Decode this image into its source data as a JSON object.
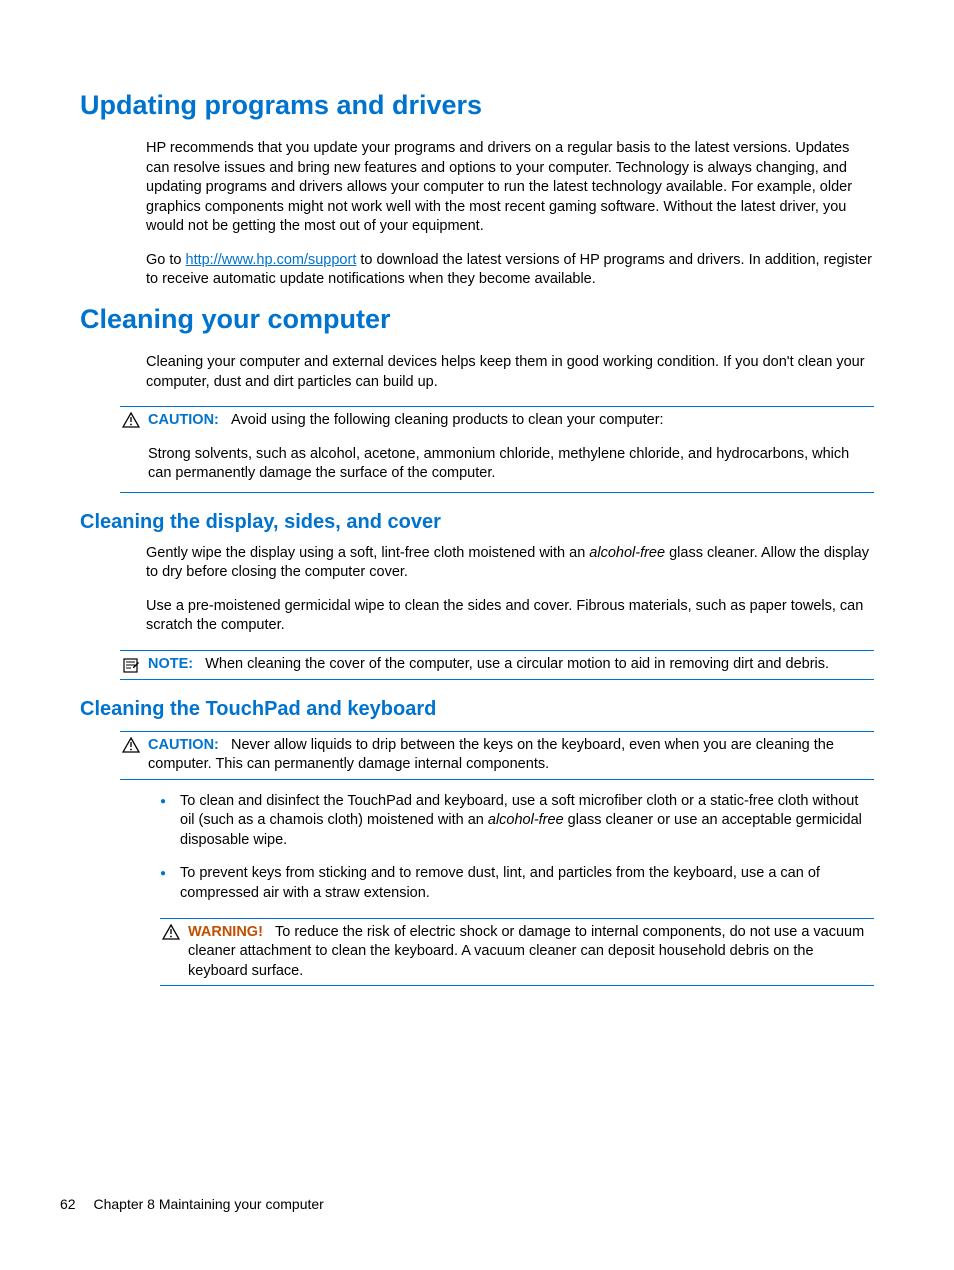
{
  "sections": {
    "updating": {
      "heading": "Updating programs and drivers",
      "p1": "HP recommends that you update your programs and drivers on a regular basis to the latest versions. Updates can resolve issues and bring new features and options to your computer. Technology is always changing, and updating programs and drivers allows your computer to run the latest technology available. For example, older graphics components might not work well with the most recent gaming software. Without the latest driver, you would not be getting the most out of your equipment.",
      "p2_before": "Go to ",
      "p2_link": "http://www.hp.com/support",
      "p2_after": " to download the latest versions of HP programs and drivers. In addition, register to receive automatic update notifications when they become available."
    },
    "cleaning": {
      "heading": "Cleaning your computer",
      "p1": "Cleaning your computer and external devices helps keep them in good working condition. If you don't clean your computer, dust and dirt particles can build up.",
      "caution_label": "CAUTION:",
      "caution_text": "Avoid using the following cleaning products to clean your computer:",
      "p2": "Strong solvents, such as alcohol, acetone, ammonium chloride, methylene chloride, and hydrocarbons, which can permanently damage the surface of the computer."
    },
    "display": {
      "heading": "Cleaning the display, sides, and cover",
      "p1_a": "Gently wipe the display using a soft, lint-free cloth moistened with an ",
      "p1_i": "alcohol-free",
      "p1_b": " glass cleaner. Allow the display to dry before closing the computer cover.",
      "p2": "Use a pre-moistened germicidal wipe to clean the sides and cover. Fibrous materials, such as paper towels, can scratch the computer.",
      "note_label": "NOTE:",
      "note_text": "When cleaning the cover of the computer, use a circular motion to aid in removing dirt and debris."
    },
    "touchpad": {
      "heading": "Cleaning the TouchPad and keyboard",
      "caution_label": "CAUTION:",
      "caution_text": "Never allow liquids to drip between the keys on the keyboard, even when you are cleaning the computer. This can permanently damage internal components.",
      "li1_a": "To clean and disinfect the TouchPad and keyboard, use a soft microfiber cloth or a static-free cloth without oil (such as a chamois cloth) moistened with an ",
      "li1_i": "alcohol-free",
      "li1_b": " glass cleaner or use an acceptable germicidal disposable wipe.",
      "li2": "To prevent keys from sticking and to remove dust, lint, and particles from the keyboard, use a can of compressed air with a straw extension.",
      "warning_label": "WARNING!",
      "warning_text": "To reduce the risk of electric shock or damage to internal components, do not use a vacuum cleaner attachment to clean the keyboard. A vacuum cleaner can deposit household debris on the keyboard surface."
    }
  },
  "footer": {
    "page_number": "62",
    "chapter": "Chapter 8   Maintaining your computer"
  }
}
